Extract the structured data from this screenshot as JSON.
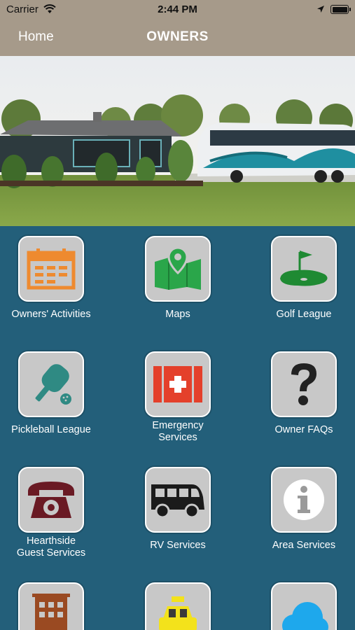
{
  "status_bar": {
    "carrier": "Carrier",
    "time": "2:44 PM"
  },
  "nav": {
    "back_label": "Home",
    "title": "OWNERS"
  },
  "hero": {
    "image": "house-and-motorcoach-photo"
  },
  "colors": {
    "bar": "#a69a8a",
    "background": "#235f7a",
    "tile": "#c8c8c8"
  },
  "tiles": [
    {
      "label_line1": "Owners' Activities",
      "label_line2": "",
      "icon": "calendar-icon"
    },
    {
      "label_line1": "Maps",
      "label_line2": "",
      "icon": "map-pin-icon"
    },
    {
      "label_line1": "Golf League",
      "label_line2": "",
      "icon": "golf-flag-icon"
    },
    {
      "label_line1": "Pickleball League",
      "label_line2": "",
      "icon": "pickleball-paddle-icon"
    },
    {
      "label_line1": "Emergency",
      "label_line2": "Services",
      "icon": "first-aid-kit-icon"
    },
    {
      "label_line1": "Owner FAQs",
      "label_line2": "",
      "icon": "question-mark-icon"
    },
    {
      "label_line1": "Hearthside",
      "label_line2": "Guest Services",
      "icon": "telephone-icon"
    },
    {
      "label_line1": "RV Services",
      "label_line2": "",
      "icon": "rv-van-icon"
    },
    {
      "label_line1": "Area Services",
      "label_line2": "",
      "icon": "info-icon"
    },
    {
      "label_line1": "",
      "label_line2": "",
      "icon": "hotel-building-icon"
    },
    {
      "label_line1": "",
      "label_line2": "",
      "icon": "taxi-icon"
    },
    {
      "label_line1": "",
      "label_line2": "",
      "icon": "cloud-icon"
    }
  ]
}
